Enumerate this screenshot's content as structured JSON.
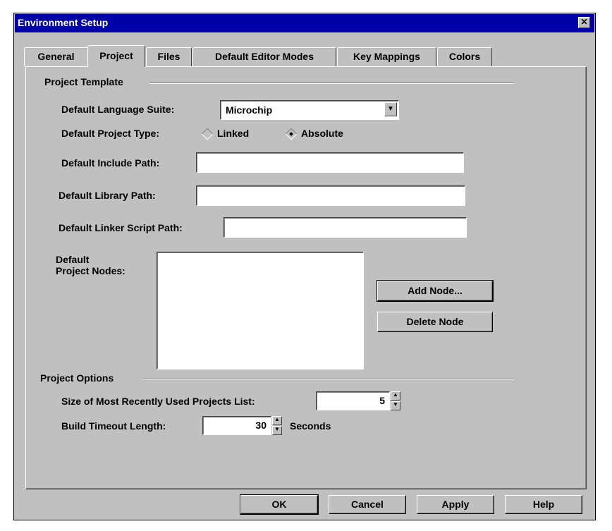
{
  "window": {
    "title": "Environment Setup",
    "close_symbol": "✕"
  },
  "tabs": [
    "General",
    "Project",
    "Files",
    "Default Editor Modes",
    "Key Mappings",
    "Colors"
  ],
  "active_tab": "Project",
  "project_template": {
    "section_label": "Project Template",
    "language_suite_label": "Default Language Suite:",
    "language_suite_value": "Microchip",
    "project_type_label": "Default Project Type:",
    "project_type_options": [
      "Linked",
      "Absolute"
    ],
    "project_type_selected": "Absolute",
    "include_path_label": "Default Include Path:",
    "include_path_value": "",
    "library_path_label": "Default Library Path:",
    "library_path_value": "",
    "linker_script_label": "Default Linker Script Path:",
    "linker_script_value": "",
    "project_nodes_label_line1": "Default",
    "project_nodes_label_line2": "Project Nodes:",
    "add_node_label": "Add Node...",
    "delete_node_label": "Delete Node"
  },
  "project_options": {
    "section_label": "Project Options",
    "mru_label": "Size of Most Recently Used Projects List:",
    "mru_value": "5",
    "timeout_label": "Build Timeout Length:",
    "timeout_value": "30",
    "timeout_unit": "Seconds"
  },
  "buttons": {
    "ok": "OK",
    "cancel": "Cancel",
    "apply": "Apply",
    "help": "Help"
  },
  "colors": {
    "titlebar": "#0000a8",
    "face": "#c0c0c0"
  }
}
